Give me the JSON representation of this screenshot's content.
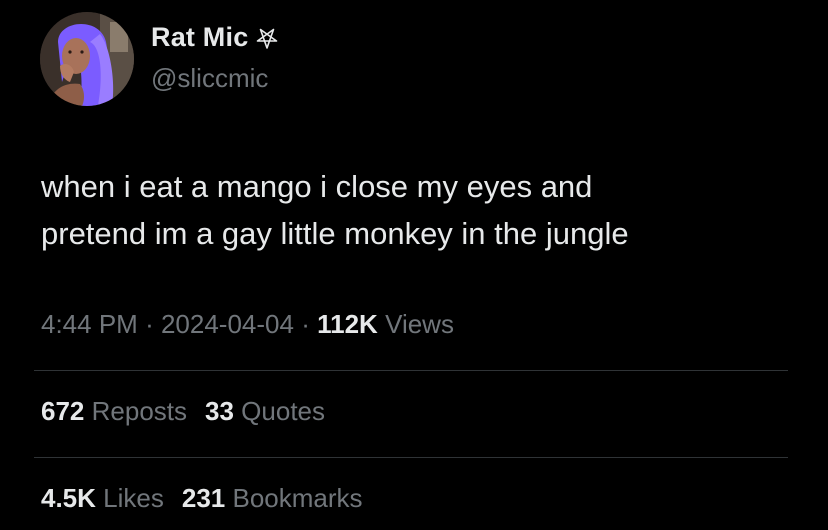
{
  "author": {
    "display_name": "Rat Mic",
    "name_symbol_icon": "inverted-pentagram-icon",
    "handle": "@sliccmic"
  },
  "tweet": {
    "text": "when i eat a mango i close my eyes and\npretend im a gay little monkey in the jungle"
  },
  "meta": {
    "time": "4:44 PM",
    "separator": "·",
    "date": "2024-04-04",
    "views_count": "112K",
    "views_label": "Views"
  },
  "stats": {
    "reposts_count": "672",
    "reposts_label": "Reposts",
    "quotes_count": "33",
    "quotes_label": "Quotes",
    "likes_count": "4.5K",
    "likes_label": "Likes",
    "bookmarks_count": "231",
    "bookmarks_label": "Bookmarks"
  },
  "colors": {
    "background": "#000000",
    "primary_text": "#e7e9ea",
    "secondary_text": "#71767b",
    "divider": "#2f3336",
    "avatar_hair": "#7b5cff"
  }
}
